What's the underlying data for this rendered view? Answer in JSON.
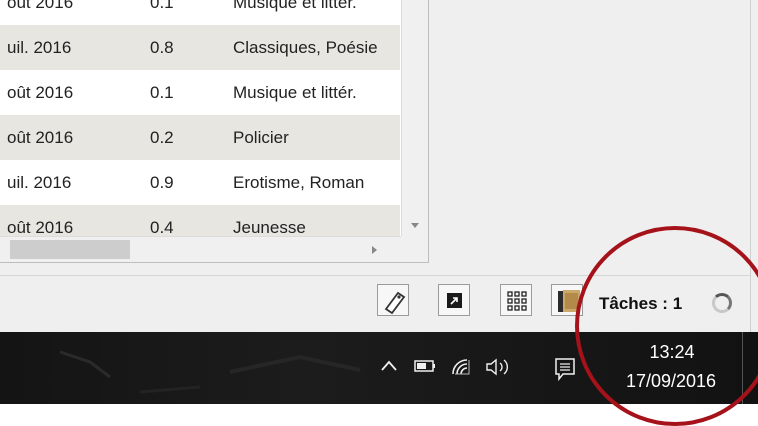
{
  "table": {
    "rows": [
      {
        "date": "oût 2016",
        "size": "0.1",
        "genre": "Musique et littér.",
        "alt": false
      },
      {
        "date": "uil. 2016",
        "size": "0.8",
        "genre": "Classiques, Poésie",
        "alt": true
      },
      {
        "date": "oût 2016",
        "size": "0.1",
        "genre": "Musique et littér.",
        "alt": false
      },
      {
        "date": "oût 2016",
        "size": "0.2",
        "genre": "Policier",
        "alt": true
      },
      {
        "date": "uil. 2016",
        "size": "0.9",
        "genre": "Erotisme, Roman",
        "alt": false
      },
      {
        "date": "oût 2016",
        "size": "0.4",
        "genre": "Jeunesse",
        "alt": true
      }
    ]
  },
  "status": {
    "tasks_label": "Tâches : 1"
  },
  "taskbar": {
    "time": "13:24",
    "date": "17/09/2016"
  },
  "colors": {
    "annotation": "#a5121a",
    "taskbar": "#161616",
    "row_alt": "#e7e6e1"
  }
}
